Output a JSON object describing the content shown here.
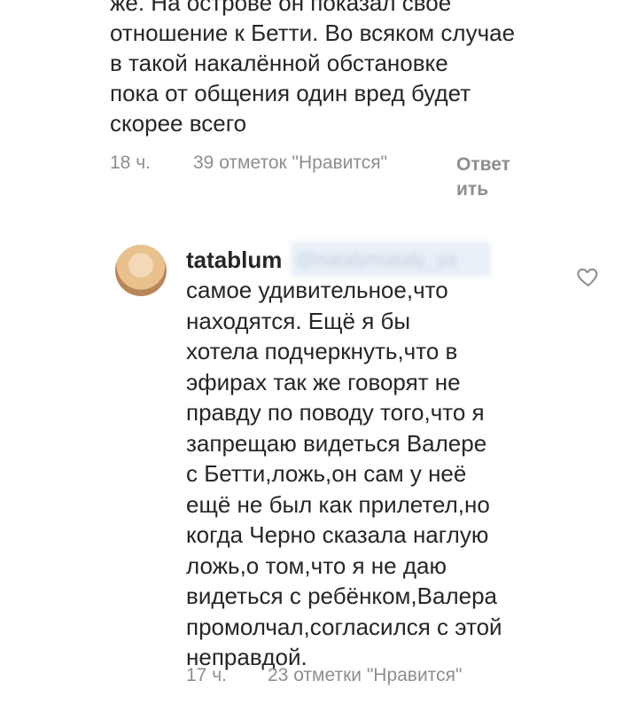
{
  "comment_1": {
    "text": "же. На острове он показал свое\nотношение к Бетти. Во всяком случае\nв такой накалённой обстановке\nпока от общения один вред будет\nскорее всего",
    "time": "18 ч.",
    "likes": "39 отметок \"Нравится\"",
    "reply": "Ответ\nить"
  },
  "comment_2": {
    "username": "tatablum",
    "mention": "@natalymataly_ya",
    "text": "самое удивительное,что\nнаходятся. Ещё я бы\nхотела подчеркнуть,что в\nэфирах так же говорят не\nправду по поводу того,что я\nзапрещаю видеться Валере\nс Бетти,ложь,он сам у неё\nещё не был как прилетел,но\nкогда Черно сказала наглую\nложь,о том,что я не даю\nвидеться с ребёнком,Валера\nпромолчал,согласился с этой\nнеправдой.",
    "time": "17 ч.",
    "likes": "23 отметки \"Нравится\""
  },
  "icons": {
    "like": "heart-outline-icon"
  },
  "colors": {
    "text": "#262626",
    "meta": "#8e8e8e",
    "background": "#ffffff"
  }
}
